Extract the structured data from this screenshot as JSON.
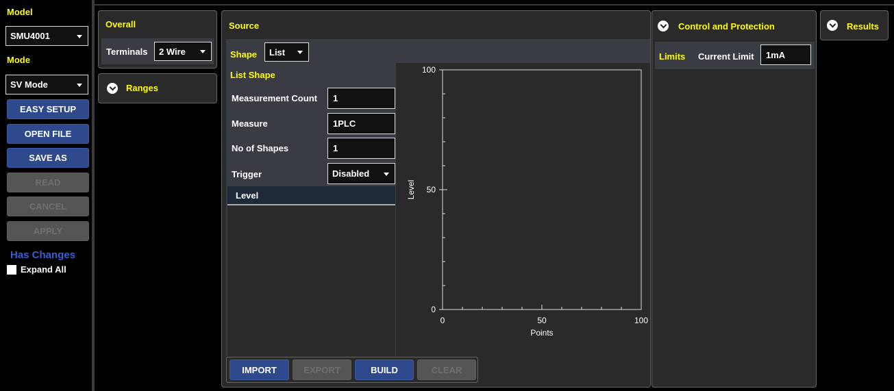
{
  "left": {
    "model_label": "Model",
    "model_value": "SMU4001",
    "mode_label": "Mode",
    "mode_value": "SV Mode",
    "buttons": {
      "easy_setup": "EASY SETUP",
      "open_file": "OPEN FILE",
      "save_as": "SAVE AS",
      "read": "READ",
      "cancel": "CANCEL",
      "apply": "APPLY"
    },
    "has_changes": "Has Changes",
    "expand_all": "Expand All"
  },
  "overall": {
    "title": "Overall",
    "terminals_label": "Terminals",
    "terminals_value": "2 Wire"
  },
  "ranges": {
    "title": "Ranges"
  },
  "source": {
    "title": "Source",
    "shape_label": "Shape",
    "shape_value": "List",
    "list_shape_title": "List Shape",
    "fields": {
      "measurement_count_label": "Measurement Count",
      "measurement_count_value": "1",
      "measure_label": "Measure",
      "measure_value": "1PLC",
      "no_of_shapes_label": "No of Shapes",
      "no_of_shapes_value": "1",
      "trigger_label": "Trigger",
      "trigger_value": "Disabled"
    },
    "table_header": "Level",
    "buttons": {
      "import": "IMPORT",
      "export": "EXPORT",
      "build": "BUILD",
      "clear": "CLEAR"
    }
  },
  "control": {
    "title": "Control and Protection",
    "limits_label": "Limits",
    "current_limit_label": "Current Limit",
    "current_limit_value": "1mA"
  },
  "results": {
    "title": "Results"
  },
  "chart_data": {
    "type": "line",
    "xlabel": "Points",
    "ylabel": "Level",
    "xlim": [
      0,
      100
    ],
    "ylim": [
      0,
      100
    ],
    "x_ticks": [
      "0",
      "50",
      "100"
    ],
    "y_ticks": [
      "0",
      "50",
      "100"
    ],
    "series": []
  }
}
